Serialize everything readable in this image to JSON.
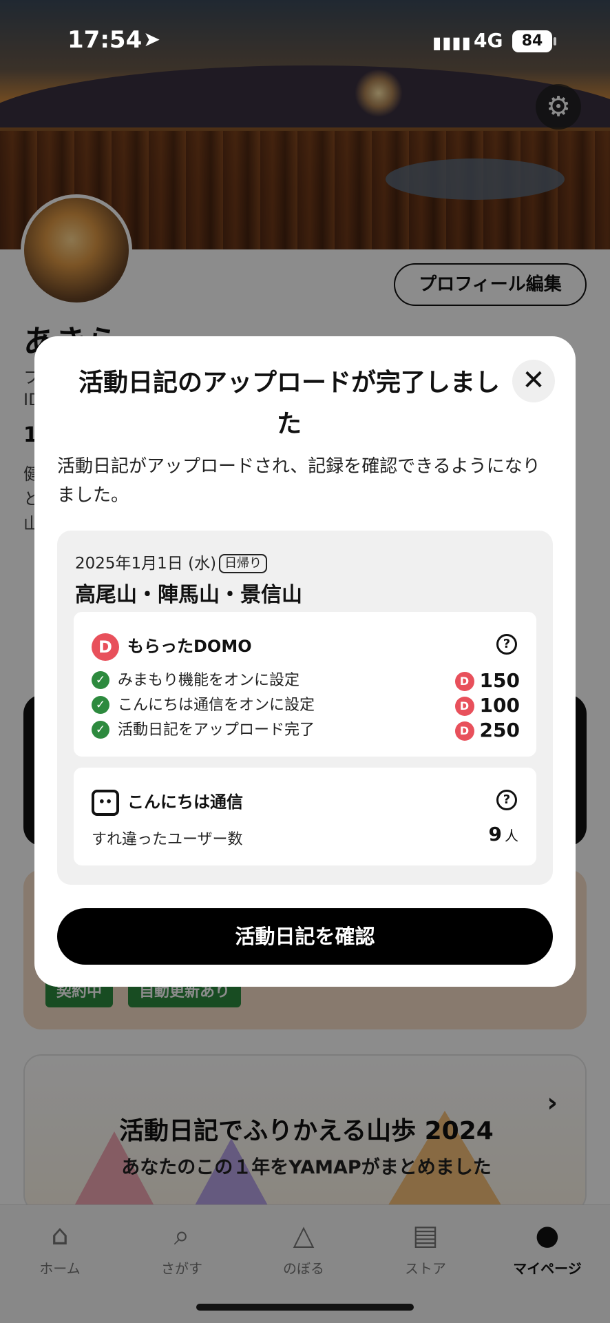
{
  "status_bar": {
    "time": "17:54",
    "network": "4G",
    "battery": "84",
    "signal_glyph": "▮▮▮▮"
  },
  "profile": {
    "edit_label": "プロフィール編集",
    "name_partial": "あきら",
    "line1": "フ",
    "line2": "ID",
    "line3": "1",
    "line4": "健",
    "line5": "と",
    "line6": "山"
  },
  "plan_tags": [
    "契約中",
    "自動更新あり"
  ],
  "review_banner": {
    "title": "活動日記でふりかえる山歩 2024",
    "subtitle": "あなたのこの１年をYAMAPがまとめました"
  },
  "tabbar": [
    {
      "label": "ホーム",
      "icon": "home-icon",
      "active": false
    },
    {
      "label": "さがす",
      "icon": "map-search-icon",
      "active": false
    },
    {
      "label": "のぼる",
      "icon": "mountain-icon",
      "active": false
    },
    {
      "label": "ストア",
      "icon": "store-icon",
      "active": false
    },
    {
      "label": "マイページ",
      "icon": "user-icon",
      "active": true
    }
  ],
  "modal": {
    "title": "活動日記のアップロードが完了しました",
    "description": "活動日記がアップロードされ、記録を確認できるようになりました。",
    "date": "2025年1月1日 (水)",
    "day_type": "日帰り",
    "route": "高尾山・陣馬山・景信山",
    "domo": {
      "title": "もらったDOMO",
      "items": [
        {
          "label": "みまもり機能をオンに設定",
          "points": "150"
        },
        {
          "label": "こんにちは通信をオンに設定",
          "points": "100"
        },
        {
          "label": "活動日記をアップロード完了",
          "points": "250"
        }
      ]
    },
    "hello": {
      "title": "こんにちは通信",
      "label": "すれ違ったユーザー数",
      "count": "9",
      "unit": "人"
    },
    "confirm_label": "活動日記を確認"
  },
  "colors": {
    "domo_red": "#e8505b",
    "check_green": "#2d8a3e",
    "plan_bg": "#f8dfc8"
  }
}
